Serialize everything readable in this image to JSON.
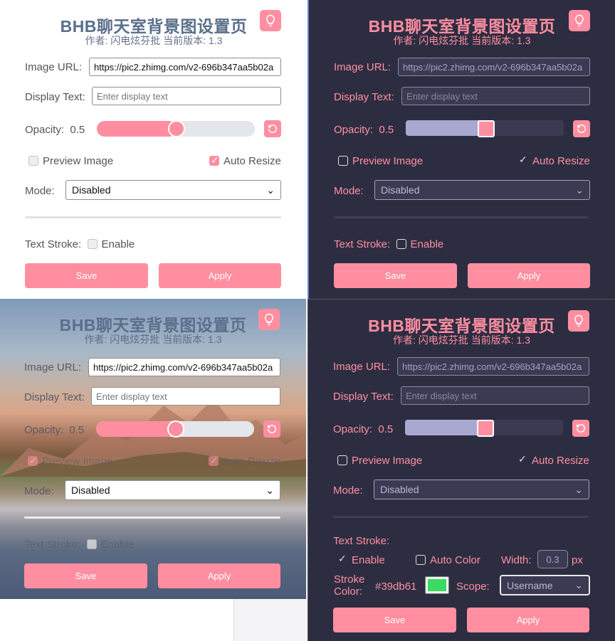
{
  "header": {
    "title": "BHB聊天室背景图设置页",
    "subtitle": "作者: 闪电炫芬批 当前版本: 1.3"
  },
  "fields": {
    "image_url_label": "Image URL:",
    "image_url_value": "https://pic2.zhimg.com/v2-696b347aa5b02a",
    "display_text_label": "Display Text:",
    "display_text_placeholder": "Enter display text",
    "opacity_label": "Opacity:",
    "opacity_value": "0.5",
    "opacity_level": 0.5,
    "preview_label": "Preview Image",
    "auto_resize_label": "Auto Resize",
    "mode_label": "Mode:",
    "mode_value": "Disabled",
    "text_stroke_label": "Text Stroke:",
    "enable_label": "Enable"
  },
  "stroke_options": {
    "auto_color_label": "Auto Color",
    "width_label": "Width:",
    "width_value": "0.3",
    "width_unit": "px",
    "stroke_color_label_line1": "Stroke",
    "stroke_color_label_line2": "Color:",
    "stroke_color_value": "#39db61",
    "scope_label": "Scope:",
    "scope_value": "Username"
  },
  "buttons": {
    "save": "Save",
    "apply": "Apply"
  },
  "colors": {
    "accent": "#ff8fa0",
    "dark_bg": "#2d2d42",
    "stroke_swatch": "#39db61"
  },
  "icons": {
    "bulb": "lightbulb-icon",
    "reset": "reset-icon",
    "dropdown": "chevron-down-icon"
  }
}
